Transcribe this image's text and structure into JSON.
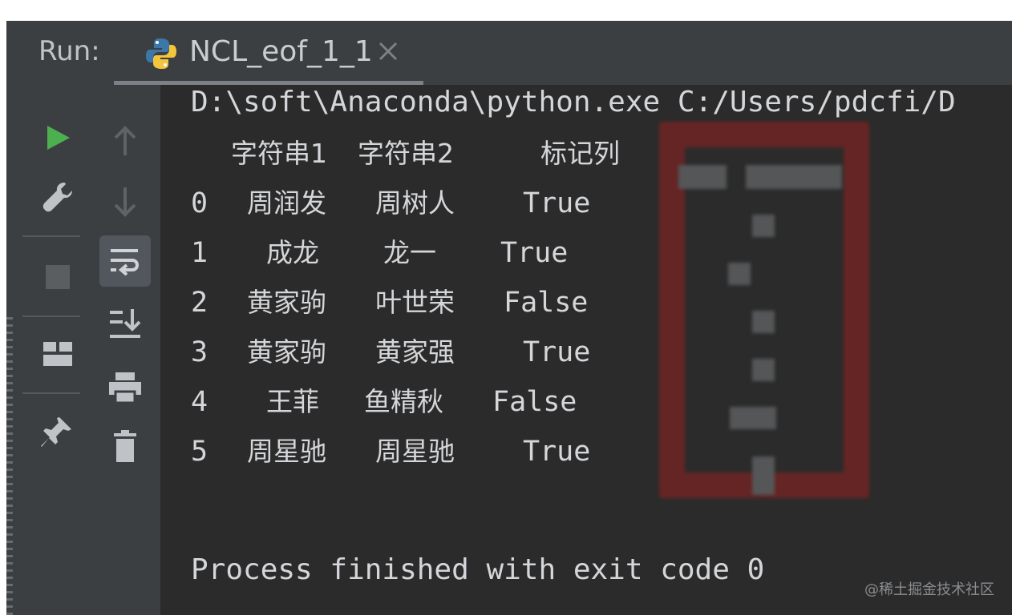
{
  "toolwindow": {
    "run_label": "Run:",
    "tab_title": "NCL_eof_1_1"
  },
  "console": {
    "command": "D:\\soft\\Anaconda\\python.exe C:/Users/pdcfi/D",
    "table": {
      "headers": [
        "字符串1",
        "字符串2",
        "标记列"
      ],
      "rows": [
        {
          "index": "0",
          "s1": "周润发",
          "s2": "周树人",
          "flag": "True"
        },
        {
          "index": "1",
          "s1": "成龙",
          "s2": "龙一",
          "flag": "True"
        },
        {
          "index": "2",
          "s1": "黄家驹",
          "s2": "叶世荣",
          "flag": "False"
        },
        {
          "index": "3",
          "s1": "黄家驹",
          "s2": "黄家强",
          "flag": "True"
        },
        {
          "index": "4",
          "s1": "王菲",
          "s2": "鱼精秋",
          "flag": "False"
        },
        {
          "index": "5",
          "s1": "周星驰",
          "s2": "周星驰",
          "flag": "True"
        }
      ]
    },
    "exit_message": "Process finished with exit code 0"
  },
  "sidebar": {
    "left_icons": [
      "run-icon",
      "wrench-icon",
      "stop-icon",
      "layout-icon",
      "pin-icon"
    ],
    "right_icons": [
      "arrow-up-icon",
      "arrow-down-icon",
      "soft-wrap-icon",
      "scroll-to-end-icon",
      "print-icon",
      "trash-icon"
    ]
  },
  "watermark": "@稀土掘金技术社区",
  "colors": {
    "background": "#2b2b2b",
    "toolbar": "#3c3f41",
    "text": "#d4d6d9",
    "run_green": "#4caf50",
    "annotation_red": "#6a2524"
  }
}
